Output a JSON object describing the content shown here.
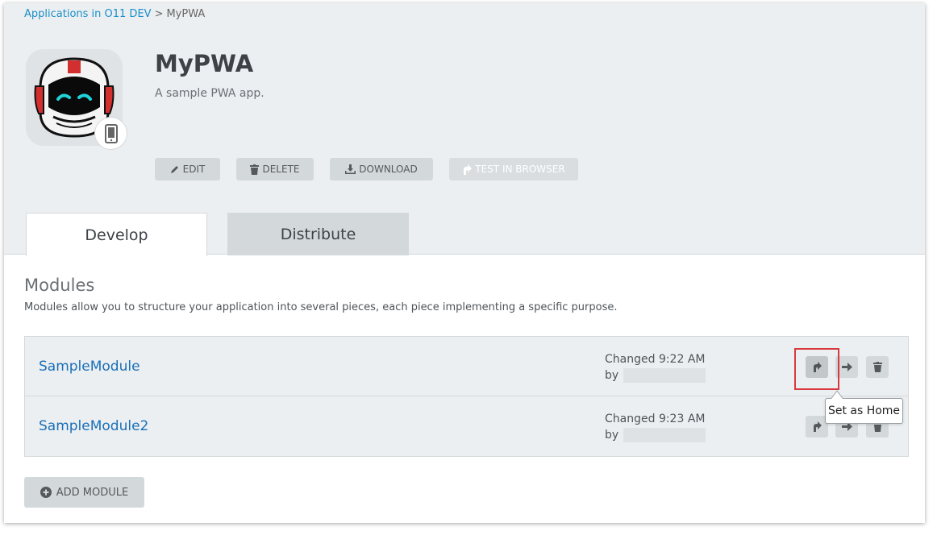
{
  "breadcrumb": {
    "parent": "Applications in O11 DEV",
    "separator": ">",
    "current": "MyPWA"
  },
  "app": {
    "title": "MyPWA",
    "description": "A sample PWA app.",
    "icon": "robot-astronaut-icon",
    "device_icon": "mobile-phone-icon"
  },
  "actions": {
    "edit": "EDIT",
    "delete": "DELETE",
    "download": "DOWNLOAD",
    "test": "TEST IN BROWSER"
  },
  "tabs": [
    {
      "label": "Develop",
      "active": true
    },
    {
      "label": "Distribute",
      "active": false
    }
  ],
  "modules": {
    "title": "Modules",
    "description": "Modules allow you to structure your application into several pieces, each piece implementing a specific purpose.",
    "rows": [
      {
        "name": "SampleModule",
        "changed": "Changed 9:22 AM",
        "by": "by"
      },
      {
        "name": "SampleModule2",
        "changed": "Changed 9:23 AM",
        "by": "by"
      }
    ],
    "add_label": "ADD MODULE"
  },
  "tooltip": {
    "text": "Set as Home"
  },
  "colors": {
    "link": "#1a8fc9",
    "module_link": "#1a6fb8",
    "highlight": "#d9383c",
    "header_bg": "#eceff1"
  }
}
